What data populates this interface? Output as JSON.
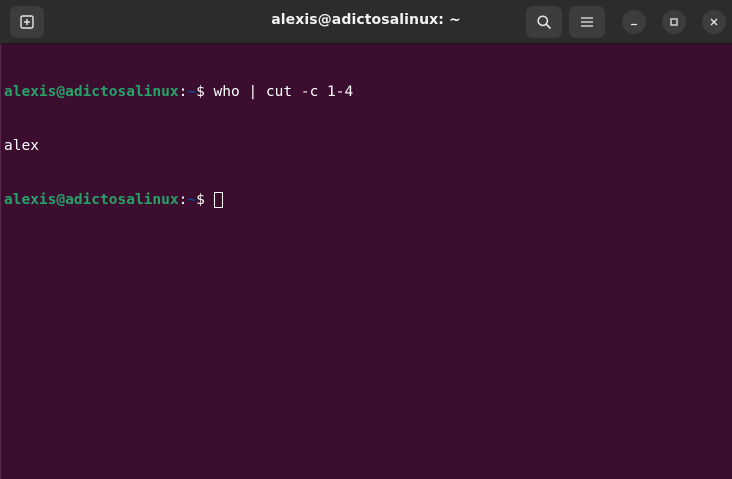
{
  "window": {
    "title": "alexis@adictosalinux: ~"
  },
  "icons": {
    "new_tab": "new-tab-icon",
    "search": "search-icon",
    "menu": "hamburger-menu-icon",
    "minimize": "minimize-icon",
    "maximize": "maximize-icon",
    "close": "close-icon"
  },
  "colors": {
    "terminal_background": "#3b0d2e",
    "titlebar_background": "#2c2c2c",
    "prompt_user_host": "#26a269",
    "prompt_path": "#12488b",
    "text": "#ffffff"
  },
  "terminal": {
    "lines": [
      {
        "user_host": "alexis@adictosalinux",
        "colon": ":",
        "path": "~",
        "dollar": "$ ",
        "command": "who | cut -c 1-4"
      },
      {
        "output": "alex"
      },
      {
        "user_host": "alexis@adictosalinux",
        "colon": ":",
        "path": "~",
        "dollar": "$ ",
        "command": ""
      }
    ]
  }
}
